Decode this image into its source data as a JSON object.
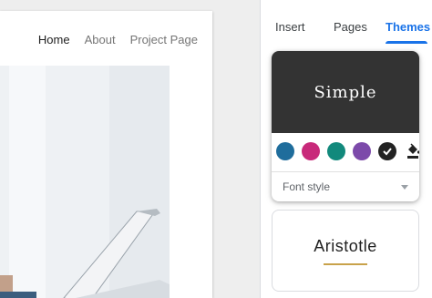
{
  "site": {
    "nav": [
      {
        "label": "Home",
        "active": true
      },
      {
        "label": "About",
        "active": false
      },
      {
        "label": "Project Page",
        "active": false
      }
    ]
  },
  "panel": {
    "tabs": [
      {
        "label": "Insert"
      },
      {
        "label": "Pages"
      },
      {
        "label": "Themes",
        "selected": true
      }
    ],
    "themes": [
      {
        "name": "Simple",
        "selected": true,
        "swatches": [
          "#1f6d9c",
          "#c8297a",
          "#12897c",
          "#7c4aaa",
          "#222222"
        ],
        "selected_swatch_index": 4,
        "fill_icon": "paint-bucket-icon",
        "font_style_label": "Font style"
      },
      {
        "name": "Aristotle",
        "accent": "#c8a24a"
      }
    ]
  },
  "colors": {
    "accent": "#1a73e8"
  }
}
